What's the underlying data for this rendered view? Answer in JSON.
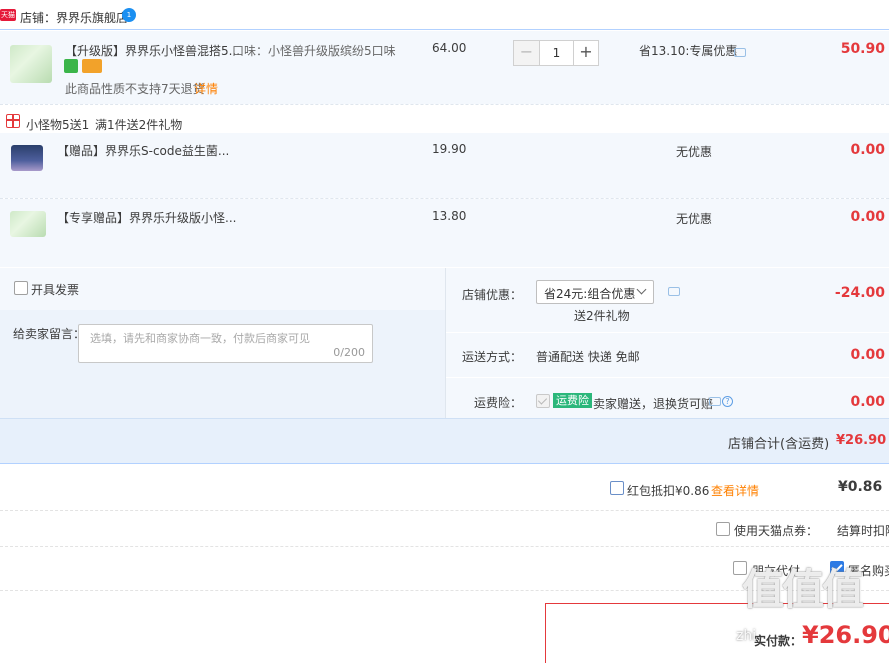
{
  "store": {
    "badge": "天猫",
    "name": "店铺：界界乐旗舰店",
    "ww_icon": "1"
  },
  "main_item": {
    "title": "【升级版】界界乐小怪兽混搭5...",
    "sku": "口味：小怪兽升级版缤纷5口味",
    "note": "此商品性质不支持7天退货",
    "detail_link": "详情",
    "unit_price": "64.00",
    "quantity": "1",
    "qty_minus": "−",
    "qty_plus": "+",
    "discount": "省13.10:专属优惠",
    "subtotal": "50.90"
  },
  "gift_promo": {
    "label": "小怪物5送1",
    "rule": "满1件送2件礼物"
  },
  "gift_items": [
    {
      "title": "【赠品】界界乐S-code益生菌...",
      "unit_price": "19.90",
      "discount": "无优惠",
      "subtotal": "0.00"
    },
    {
      "title": "【专享赠品】界界乐升级版小怪...",
      "unit_price": "13.80",
      "discount": "无优惠",
      "subtotal": "0.00"
    }
  ],
  "invoice": {
    "label": "开具发票"
  },
  "message": {
    "label": "给卖家留言：",
    "placeholder": "选填，请先和商家协商一致，付款后商家可见",
    "count": "0/200"
  },
  "store_discount": {
    "label": "店铺优惠：",
    "selected": "省24元:组合优惠",
    "sub": "送2件礼物",
    "amount": "-24.00"
  },
  "shipping": {
    "label": "运送方式：",
    "value": "普通配送 快递 免邮",
    "amount": "0.00"
  },
  "insurance": {
    "label": "运费险：",
    "tag": "运费险",
    "desc": "卖家赠送，退换货可赔",
    "amount": "0.00"
  },
  "store_total": {
    "label": "店铺合计(含运费)",
    "amount": "¥26.90"
  },
  "red_packet": {
    "label": "红包抵扣¥0.86",
    "link": "查看详情",
    "amount": "¥0.86"
  },
  "tmall_points": {
    "label": "使用天猫点券：",
    "note": "结算时扣除"
  },
  "options": {
    "friend_pay": "朋友代付",
    "anonymous": "匿名购买"
  },
  "pay_total": {
    "label": "实付款：",
    "amount": "¥26.90"
  },
  "watermark": {
    "text": "值值值",
    "sub": "zhi"
  },
  "colors": {
    "accent_red": "#e4393c",
    "link_orange": "#ff8000",
    "tag_green": "#2bb77b",
    "border_blue": "#b2d1ff"
  }
}
